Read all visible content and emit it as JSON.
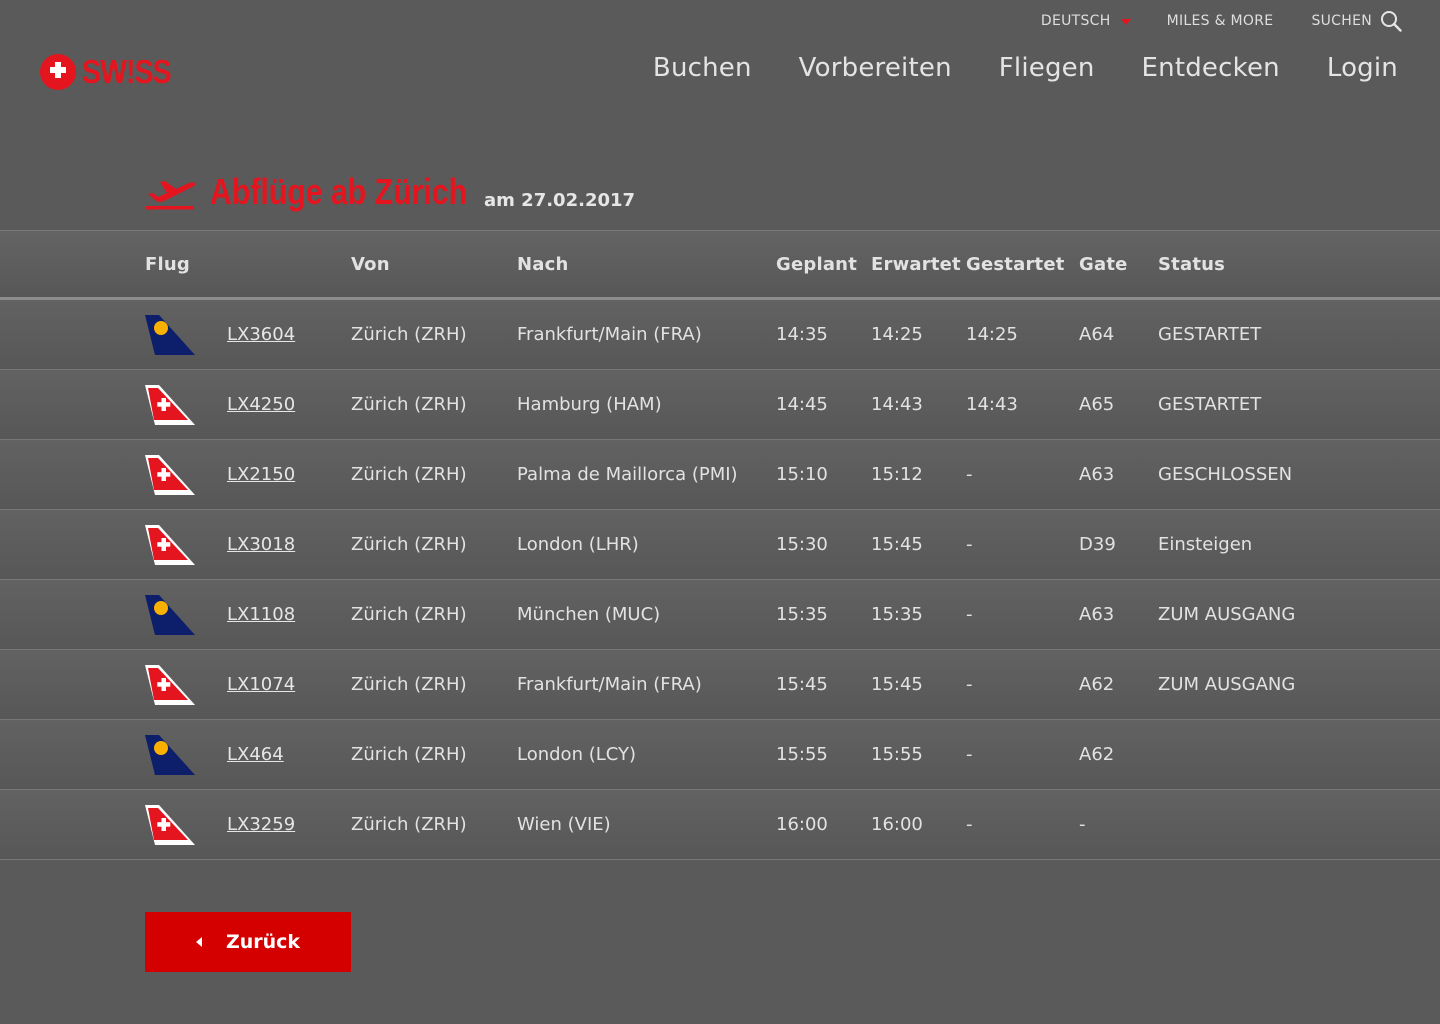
{
  "utility": {
    "language": "DEUTSCH",
    "miles": "MILES & MORE",
    "search": "SUCHEN"
  },
  "logo": {
    "text": "SW!SS"
  },
  "nav": {
    "items": [
      {
        "label": "Buchen"
      },
      {
        "label": "Vorbereiten"
      },
      {
        "label": "Fliegen"
      },
      {
        "label": "Entdecken"
      },
      {
        "label": "Login"
      }
    ]
  },
  "page": {
    "title": "Abflüge ab Zürich",
    "date": "am 27.02.2017"
  },
  "table": {
    "headers": {
      "flug": "Flug",
      "von": "Von",
      "nach": "Nach",
      "geplant": "Geplant",
      "erwartet": "Erwartet",
      "gestartet": "Gestartet",
      "gate": "Gate",
      "status": "Status"
    },
    "rows": [
      {
        "airline": "lufthansa-tail-icon",
        "flight": "LX3604",
        "from": "Zürich (ZRH)",
        "to": "Frankfurt/Main (FRA)",
        "planned": "14:35",
        "expected": "14:25",
        "departed": "14:25",
        "gate": "A64",
        "status": "GESTARTET"
      },
      {
        "airline": "swiss-tail-icon",
        "flight": "LX4250",
        "from": "Zürich (ZRH)",
        "to": "Hamburg (HAM)",
        "planned": "14:45",
        "expected": "14:43",
        "departed": "14:43",
        "gate": "A65",
        "status": "GESTARTET"
      },
      {
        "airline": "swiss-tail-icon",
        "flight": "LX2150",
        "from": "Zürich (ZRH)",
        "to": "Palma de Maillorca (PMI)",
        "planned": "15:10",
        "expected": "15:12",
        "departed": "-",
        "gate": "A63",
        "status": "GESCHLOSSEN"
      },
      {
        "airline": "swiss-tail-icon",
        "flight": "LX3018",
        "from": "Zürich (ZRH)",
        "to": "London (LHR)",
        "planned": "15:30",
        "expected": "15:45",
        "departed": "-",
        "gate": "D39",
        "status": "Einsteigen"
      },
      {
        "airline": "lufthansa-tail-icon",
        "flight": "LX1108",
        "from": "Zürich (ZRH)",
        "to": "München (MUC)",
        "planned": "15:35",
        "expected": "15:35",
        "departed": "-",
        "gate": "A63",
        "status": "ZUM AUSGANG"
      },
      {
        "airline": "swiss-tail-icon",
        "flight": "LX1074",
        "from": "Zürich (ZRH)",
        "to": "Frankfurt/Main (FRA)",
        "planned": "15:45",
        "expected": "15:45",
        "departed": "-",
        "gate": "A62",
        "status": "ZUM AUSGANG"
      },
      {
        "airline": "lufthansa-tail-icon",
        "flight": "LX464",
        "from": "Zürich (ZRH)",
        "to": "London (LCY)",
        "planned": "15:55",
        "expected": "15:55",
        "departed": "-",
        "gate": "A62",
        "status": ""
      },
      {
        "airline": "swiss-tail-icon",
        "flight": "LX3259",
        "from": "Zürich (ZRH)",
        "to": "Wien (VIE)",
        "planned": "16:00",
        "expected": "16:00",
        "departed": "-",
        "gate": "-",
        "status": ""
      }
    ]
  },
  "back_button": {
    "label": "Zurück"
  },
  "colors": {
    "background": "#5a5a5a",
    "brand_red": "#e4151f",
    "button_red": "#d40000",
    "lufthansa_blue": "#0d1f6b",
    "lufthansa_yellow": "#f9b000"
  }
}
